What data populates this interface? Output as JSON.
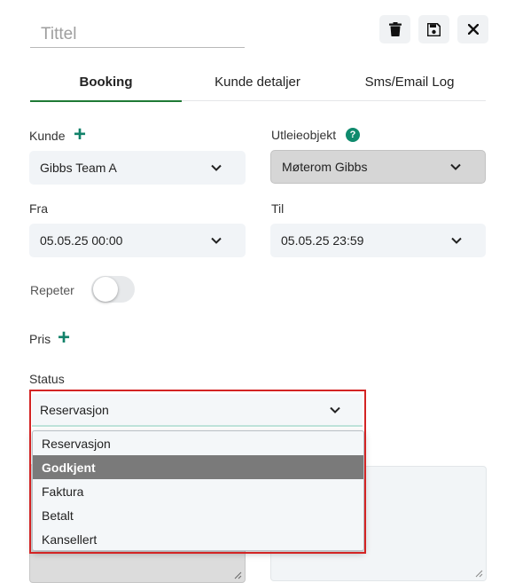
{
  "header": {
    "title_placeholder": "Tittel",
    "delete_icon": "trash-icon",
    "save_icon": "save-icon",
    "close_icon": "close-icon"
  },
  "tabs": [
    {
      "label": "Booking",
      "active": true
    },
    {
      "label": "Kunde detaljer",
      "active": false
    },
    {
      "label": "Sms/Email Log",
      "active": false
    }
  ],
  "kunde": {
    "label": "Kunde",
    "value": "Gibbs Team A"
  },
  "utleieobjekt": {
    "label": "Utleieobjekt",
    "value": "Møterom Gibbs",
    "help": "?"
  },
  "fra": {
    "label": "Fra",
    "value": "05.05.25 00:00"
  },
  "til": {
    "label": "Til",
    "value": "05.05.25 23:59"
  },
  "repeter": {
    "label": "Repeter",
    "on": false
  },
  "pris": {
    "label": "Pris"
  },
  "status": {
    "label": "Status",
    "value": "Reservasjon",
    "options": [
      "Reservasjon",
      "Godkjent",
      "Faktura",
      "Betalt",
      "Kansellert"
    ],
    "highlighted": "Godkjent"
  },
  "colors": {
    "accent": "#1f7a35",
    "plus": "#12826a",
    "highlight": "#7a7a7a",
    "annotation": "#d32424"
  }
}
